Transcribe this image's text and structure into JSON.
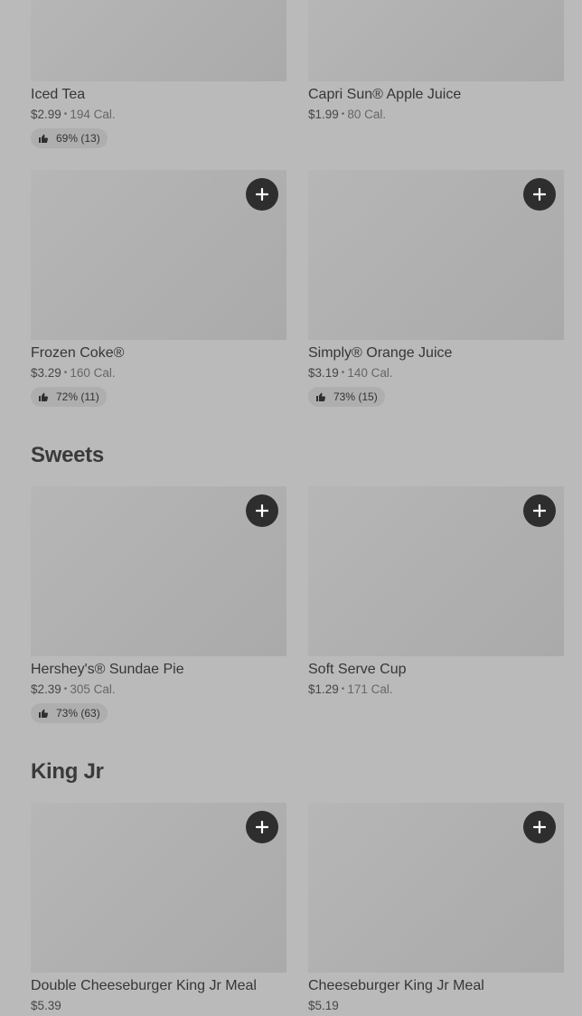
{
  "drinks_top": [
    {
      "name": "Iced Tea",
      "price": "$2.99",
      "cal": "194 Cal.",
      "rating": "69% (13)"
    },
    {
      "name": "Capri Sun® Apple Juice",
      "price": "$1.99",
      "cal": "80 Cal."
    }
  ],
  "drinks": [
    {
      "name": "Frozen Coke®",
      "price": "$3.29",
      "cal": "160 Cal.",
      "rating": "72% (11)"
    },
    {
      "name": "Simply® Orange Juice",
      "price": "$3.19",
      "cal": "140 Cal.",
      "rating": "73% (15)"
    }
  ],
  "sweets": {
    "title": "Sweets",
    "items": [
      {
        "name": "Hershey's® Sundae Pie",
        "price": "$2.39",
        "cal": "305 Cal.",
        "rating": "73% (63)"
      },
      {
        "name": "Soft Serve Cup",
        "price": "$1.29",
        "cal": "171 Cal."
      }
    ]
  },
  "king_jr": {
    "title": "King Jr",
    "items": [
      {
        "name": "Double Cheeseburger King Jr Meal",
        "price": "$5.39"
      },
      {
        "name": "Cheeseburger King Jr Meal",
        "price": "$5.19"
      }
    ]
  },
  "icons": {
    "add": "plus-icon",
    "rating": "thumbs-up-icon"
  },
  "colors": {
    "background": "#bababa",
    "add_button": "#2e2e2e"
  }
}
